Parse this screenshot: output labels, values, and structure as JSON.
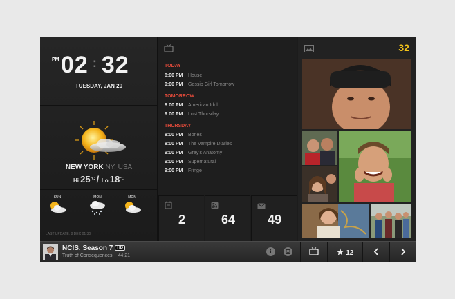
{
  "clock": {
    "ampm": "PM",
    "hours": "02",
    "minutes": "32",
    "date": "TUESDAY, JAN 20"
  },
  "weather": {
    "city": "NEW YORK",
    "state": "NY, USA",
    "hi_label": "Hi",
    "hi": "25",
    "lo_label": "Lo",
    "lo": "18",
    "unit": "°C",
    "icon": "sun-cloud-icon",
    "forecast": [
      {
        "day": "SUN",
        "icon": "sun-cloud-icon"
      },
      {
        "day": "MON",
        "icon": "snow-cloud-icon"
      },
      {
        "day": "MON",
        "icon": "sun-cloud-icon"
      }
    ],
    "last_update": "LAST UPDATE: 8 DEC 01:30"
  },
  "tv": {
    "icon": "tv-icon",
    "days": [
      {
        "day": "TODAY",
        "shows": [
          {
            "time": "8:00 PM",
            "title": "House"
          },
          {
            "time": "9:00 PM",
            "title": "Gossip Girl Tomorrow"
          }
        ]
      },
      {
        "day": "TOMORROW",
        "shows": [
          {
            "time": "8:00 PM",
            "title": "American Idol"
          },
          {
            "time": "9:00 PM",
            "title": "Lost Thursday"
          }
        ]
      },
      {
        "day": "THURSDAY",
        "shows": [
          {
            "time": "8:00 PM",
            "title": "Bones"
          },
          {
            "time": "8:00 PM",
            "title": "The Vampire Diaries"
          },
          {
            "time": "9:00 PM",
            "title": "Grey's Anatomy"
          },
          {
            "time": "9:00 PM",
            "title": "Supernatural"
          },
          {
            "time": "9:00 PM",
            "title": "Fringe"
          }
        ]
      }
    ]
  },
  "counters": [
    {
      "icon": "calendar-icon",
      "value": "2"
    },
    {
      "icon": "rss-icon",
      "value": "64"
    },
    {
      "icon": "mail-icon",
      "value": "49"
    }
  ],
  "photos": {
    "icon": "photo-icon",
    "count": "32"
  },
  "now_playing": {
    "title": "NCIS, Season 7",
    "badge": "HD",
    "episode": "Truth of Consequences",
    "duration": "44:21"
  },
  "toolbar": {
    "info_icon": "info-icon",
    "list_icon": "list-icon",
    "tv_icon": "tv-icon",
    "star_count": "12",
    "prev_icon": "chevron-left-icon",
    "next_icon": "chevron-right-icon"
  },
  "colors": {
    "accent_yellow": "#f2c21a",
    "day_header_red": "#e04a3a",
    "panel_dark": "#1c1c1c",
    "page_bg": "#e9e9e9"
  }
}
